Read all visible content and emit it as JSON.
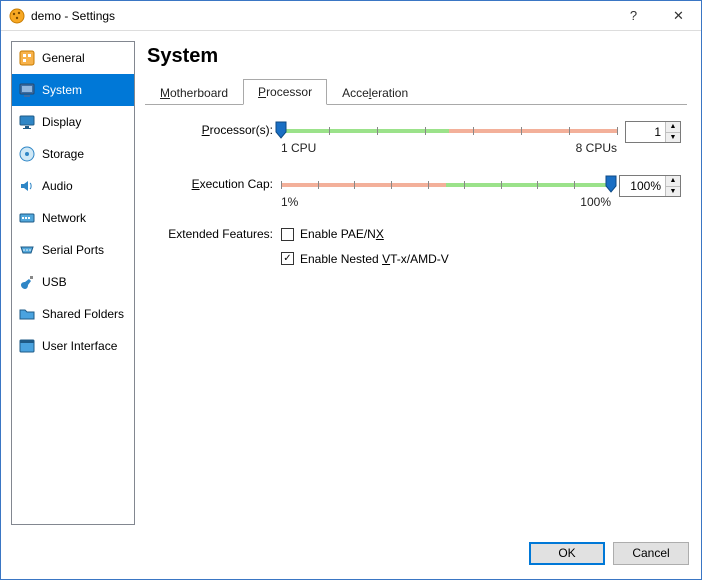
{
  "title": "demo - Settings",
  "sidebar": {
    "items": [
      {
        "label": "General"
      },
      {
        "label": "System"
      },
      {
        "label": "Display"
      },
      {
        "label": "Storage"
      },
      {
        "label": "Audio"
      },
      {
        "label": "Network"
      },
      {
        "label": "Serial Ports"
      },
      {
        "label": "USB"
      },
      {
        "label": "Shared Folders"
      },
      {
        "label": "User Interface"
      }
    ],
    "selected_index": 1
  },
  "page": {
    "title": "System"
  },
  "tabs": {
    "items": [
      "Motherboard",
      "Processor",
      "Acceleration"
    ],
    "active_index": 1
  },
  "processor": {
    "label_processors": "Processor(s):",
    "label_exec_cap": "Execution Cap:",
    "label_features": "Extended Features:",
    "cpu_slider": {
      "min_label": "1 CPU",
      "max_label": "8 CPUs",
      "value": 1,
      "min": 1,
      "max": 8,
      "green_fraction": 0.5
    },
    "cpu_spinner": "1",
    "cap_slider": {
      "min_label": "1%",
      "max_label": "100%",
      "value": 100,
      "min": 1,
      "max": 100,
      "orange_fraction": 0.5
    },
    "cap_spinner": "100%",
    "feature_pae": {
      "label": "Enable PAE/NX",
      "checked": false
    },
    "feature_nested": {
      "label": "Enable Nested VT-x/AMD-V",
      "checked": true
    }
  },
  "footer": {
    "ok": "OK",
    "cancel": "Cancel"
  },
  "titlebar": {
    "help": "?",
    "close": "✕"
  }
}
